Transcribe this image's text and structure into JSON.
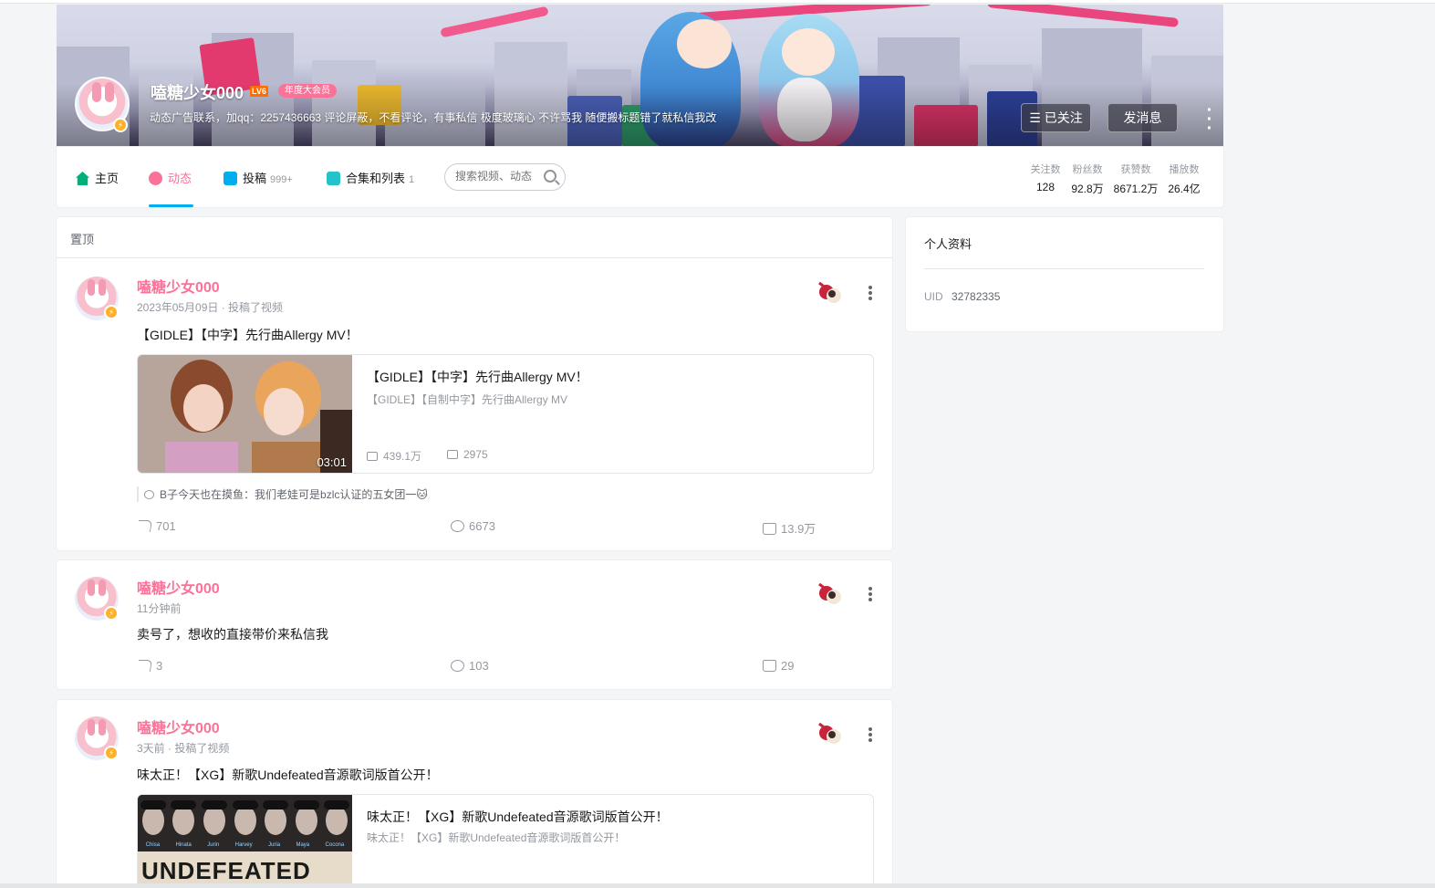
{
  "profile": {
    "name": "嗑糖少女000",
    "level": "LV6",
    "vip_label": "年度大会员",
    "signature": "动态广告联系，加qq：2257436663 评论屏蔽，不看评论，有事私信 极度玻璃心 不许骂我 随便搬标题错了就私信我改",
    "follow_button": "已关注",
    "message_button": "发消息"
  },
  "nav": {
    "tabs": [
      {
        "label": "主页",
        "count": ""
      },
      {
        "label": "动态",
        "count": ""
      },
      {
        "label": "投稿",
        "count": "999+"
      },
      {
        "label": "合集和列表",
        "count": "1"
      }
    ],
    "search_placeholder": "搜索视频、动态"
  },
  "stats": [
    {
      "label": "关注数",
      "value": "128"
    },
    {
      "label": "粉丝数",
      "value": "92.8万"
    },
    {
      "label": "获赞数",
      "value": "8671.2万"
    },
    {
      "label": "播放数",
      "value": "26.4亿"
    }
  ],
  "pinned_label": "置顶",
  "posts": [
    {
      "author": "嗑糖少女000",
      "meta": "2023年05月09日 · 投稿了视频",
      "text": "【GIDLE】【中字】先行曲Allergy MV！",
      "video": {
        "title": "【GIDLE】【中字】先行曲Allergy MV！",
        "desc": "【GIDLE】【自制中字】先行曲Allergy MV",
        "duration": "03:01",
        "plays": "439.1万",
        "danmaku": "2975"
      },
      "hot_comment_user": "B子今天也在摸鱼",
      "hot_comment_text": "：我们老娃可是bzlc认证的五女团一🐱",
      "forwards": "701",
      "comments": "6673",
      "likes": "13.9万"
    },
    {
      "author": "嗑糖少女000",
      "meta": "11分钟前",
      "text": "卖号了，想收的直接带价来私信我",
      "forwards": "3",
      "comments": "103",
      "likes": "29"
    },
    {
      "author": "嗑糖少女000",
      "meta": "3天前 · 投稿了视频",
      "text": "味太正！【XG】新歌Undefeated音源歌词版首公开！",
      "video": {
        "title": "味太正！【XG】新歌Undefeated音源歌词版首公开！",
        "desc": "味太正！【XG】新歌Undefeated音源歌词版首公开！",
        "thumb_text": "UNDEFEATED",
        "members": [
          "Chisa",
          "Hinata",
          "Jurin",
          "Harvey",
          "Juria",
          "Maya",
          "Cocona"
        ]
      }
    }
  ],
  "side": {
    "title": "个人资料",
    "uid_label": "UID",
    "uid_value": "32782335"
  },
  "colors": {
    "accent_pink": "#fb7299",
    "accent_blue": "#00aeec",
    "text_gray": "#9499a0"
  }
}
